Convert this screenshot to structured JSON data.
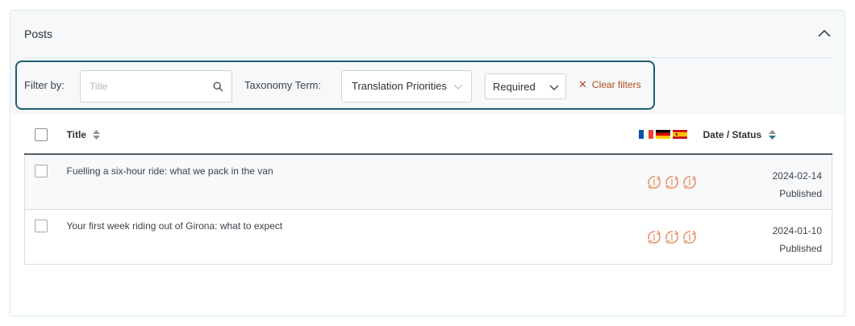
{
  "panel": {
    "title": "Posts",
    "collapse_icon": "chevron-up-icon"
  },
  "filters": {
    "label": "Filter by:",
    "search_placeholder": "Title",
    "search_value": "",
    "taxonomy_label": "Taxonomy Term:",
    "taxonomy_select": "Translation Priorities",
    "priority_select": "Required",
    "clear_label": "Clear filters"
  },
  "table": {
    "columns": {
      "title": "Title",
      "date_status": "Date / Status"
    },
    "languages": [
      {
        "code": "fr",
        "icon": "france-flag-icon",
        "colors": [
          "#0055a4",
          "#ffffff",
          "#ef4135"
        ]
      },
      {
        "code": "de",
        "icon": "germany-flag-icon",
        "colors": [
          "#000000",
          "#dd0000",
          "#ffce00"
        ]
      },
      {
        "code": "es",
        "icon": "spain-flag-icon",
        "colors": [
          "#c60b1e",
          "#ffc400",
          "#c60b1e"
        ]
      }
    ],
    "rows": [
      {
        "title": "Fuelling a six-hour ride: what we pack in the van",
        "date": "2024-02-14",
        "status": "Published"
      },
      {
        "title": "Your first week riding out of Girona: what to expect",
        "date": "2024-01-10",
        "status": "Published"
      }
    ]
  },
  "colors": {
    "accent": "#1d5f6e",
    "clear": "#b44a1e",
    "sync": "#e8956b"
  }
}
